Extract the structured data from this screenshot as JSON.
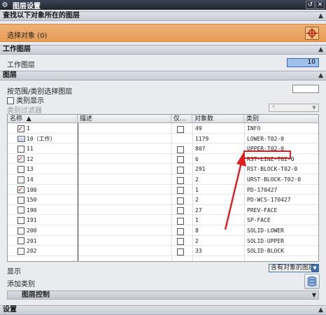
{
  "window": {
    "title": "图层设置",
    "btn_reset": "↺",
    "btn_close": "✕"
  },
  "sections": {
    "find": "查找以下对象所在的图层",
    "work_layer": "工作图层",
    "layers": "图层",
    "settings": "设置"
  },
  "select_objects": {
    "label": "选择对象 (0)"
  },
  "work_layer": {
    "label": "工作图层",
    "value": "10"
  },
  "layers": {
    "by_range_label": "按范围/类别选择图层",
    "category_display_label": "类别显示",
    "category_filter_label": "类别过滤器",
    "category_filter_value": "*"
  },
  "table": {
    "columns": [
      "名称",
      "描述",
      "仅...",
      "对象数",
      "类别"
    ],
    "sort_indicator": "▲",
    "rows": [
      {
        "name": "1",
        "checked": true,
        "work": false,
        "desc": "",
        "only": true,
        "count": "49",
        "category": "INFO"
      },
      {
        "name": "10（工作）",
        "checked": false,
        "work": true,
        "desc": "",
        "only": false,
        "count": "1179",
        "category": "LOWER-T02-0"
      },
      {
        "name": "11",
        "checked": false,
        "work": false,
        "desc": "",
        "only": true,
        "count": "807",
        "category": "UPPER-T02-0"
      },
      {
        "name": "12",
        "checked": true,
        "work": false,
        "desc": "",
        "only": true,
        "count": "6",
        "category": "RST-LINE-T02-0"
      },
      {
        "name": "13",
        "checked": false,
        "work": false,
        "desc": "",
        "only": true,
        "count": "291",
        "category": "RST-BLOCK-T02-0"
      },
      {
        "name": "14",
        "checked": false,
        "work": false,
        "desc": "",
        "only": true,
        "count": "2",
        "category": "URST-BLOCK-T02-0"
      },
      {
        "name": "100",
        "checked": true,
        "work": false,
        "desc": "",
        "only": true,
        "count": "1",
        "category": "PD-170427"
      },
      {
        "name": "150",
        "checked": false,
        "work": false,
        "desc": "",
        "only": true,
        "count": "2",
        "category": "PD-WCS-170427"
      },
      {
        "name": "190",
        "checked": false,
        "work": false,
        "desc": "",
        "only": true,
        "count": "27",
        "category": "PREV-FACE"
      },
      {
        "name": "191",
        "checked": false,
        "work": false,
        "desc": "",
        "only": true,
        "count": "1",
        "category": "SP-FACE"
      },
      {
        "name": "200",
        "checked": false,
        "work": false,
        "desc": "",
        "only": true,
        "count": "8",
        "category": "SOLID-LOWER"
      },
      {
        "name": "201",
        "checked": false,
        "work": false,
        "desc": "",
        "only": true,
        "count": "2",
        "category": "SOLID-UPPER"
      },
      {
        "name": "202",
        "checked": false,
        "work": false,
        "desc": "",
        "only": true,
        "count": "33",
        "category": "SOLID-BLOCK"
      }
    ]
  },
  "bottom": {
    "display_label": "显示",
    "display_value": "含有对象的图层",
    "add_category_label": "添加类别",
    "layer_control_label": "图层控制"
  },
  "colors": {
    "accent_orange": "#e79c55",
    "highlight_red": "#e02020",
    "work_field_blue": "#9ec0ea"
  }
}
